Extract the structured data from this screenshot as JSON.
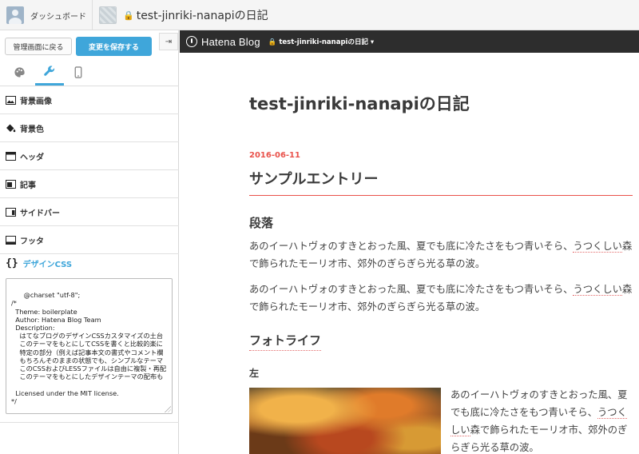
{
  "topbar": {
    "dashboard_label": "ダッシュボード",
    "blog_title": "test-jinriki-nanapiの日記"
  },
  "sidebar": {
    "back_button": "管理画面に戻る",
    "save_button": "変更を保存する",
    "collapse_icon": "⇥",
    "tabs": [
      {
        "name": "design-tab",
        "icon": "palette-icon",
        "active": false
      },
      {
        "name": "customize-tab",
        "icon": "wrench-icon",
        "active": true
      },
      {
        "name": "smartphone-tab",
        "icon": "smartphone-icon",
        "active": false
      }
    ],
    "sections": [
      {
        "label": "背景画像",
        "icon": "image-icon"
      },
      {
        "label": "背景色",
        "icon": "paint-bucket-icon"
      },
      {
        "label": "ヘッダ",
        "icon": "header-layout-icon"
      },
      {
        "label": "記事",
        "icon": "article-layout-icon"
      },
      {
        "label": "サイドバー",
        "icon": "sidebar-layout-icon"
      },
      {
        "label": "フッタ",
        "icon": "footer-layout-icon"
      }
    ],
    "design_css": {
      "brace": "{}",
      "label": "デザインCSS",
      "code": "@charset \"utf-8\";\n/*\n  Theme: boilerplate\n  Author: Hatena Blog Team\n  Description:\n    はてなブログのデザインCSSカスタマイズの土台\n    このテーマをもとにしてCSSを書くと比較的楽に\n    特定の部分（例えば記事本文の書式やコメント欄\n    もちろんそのままの状態でも、シンプルなテーマ\n    このCSSおよびLESSファイルは自由に複製・再配\n    このテーマをもとにしたデザインテーマの配布も\n\n  Licensed under the MIT license.\n*/"
    }
  },
  "preview": {
    "logo": "Hatena Blog",
    "blog_menu": "test-jinriki-nanapiの日記 ▾",
    "blog_title": "test-jinriki-nanapiの日記",
    "entry_date": "2016-06-11",
    "entry_title": "サンプルエントリー",
    "heading_paragraph": "段落",
    "para1_a": "あのイーハトヴォのすきとおった風、夏でも底に冷たさをもつ青いそら、",
    "para1_link": "うつくしい",
    "para1_b": "森で飾られたモーリオ市、郊外のぎらぎら光る草の波。",
    "para2_a": "あのイーハトヴォのすきとおった風、夏でも底に冷たさをもつ青いそら、",
    "para2_link": "うつくしい",
    "para2_b": "森で飾られたモーリオ市、郊外のぎらぎら光る草の波。",
    "heading_photo": "フォトライフ",
    "heading_left": "左",
    "photo_text_a": "あのイーハトヴォのすきとおった風、夏でも底に冷たさをもつ青いそら、",
    "photo_text_link": "うつくしい",
    "photo_text_b": "森で飾られたモーリオ市、郊外のぎらぎら光る草の波。"
  },
  "colors": {
    "accent": "#3fa6da",
    "date_red": "#e9524b",
    "preview_header": "#2d2d2d"
  }
}
